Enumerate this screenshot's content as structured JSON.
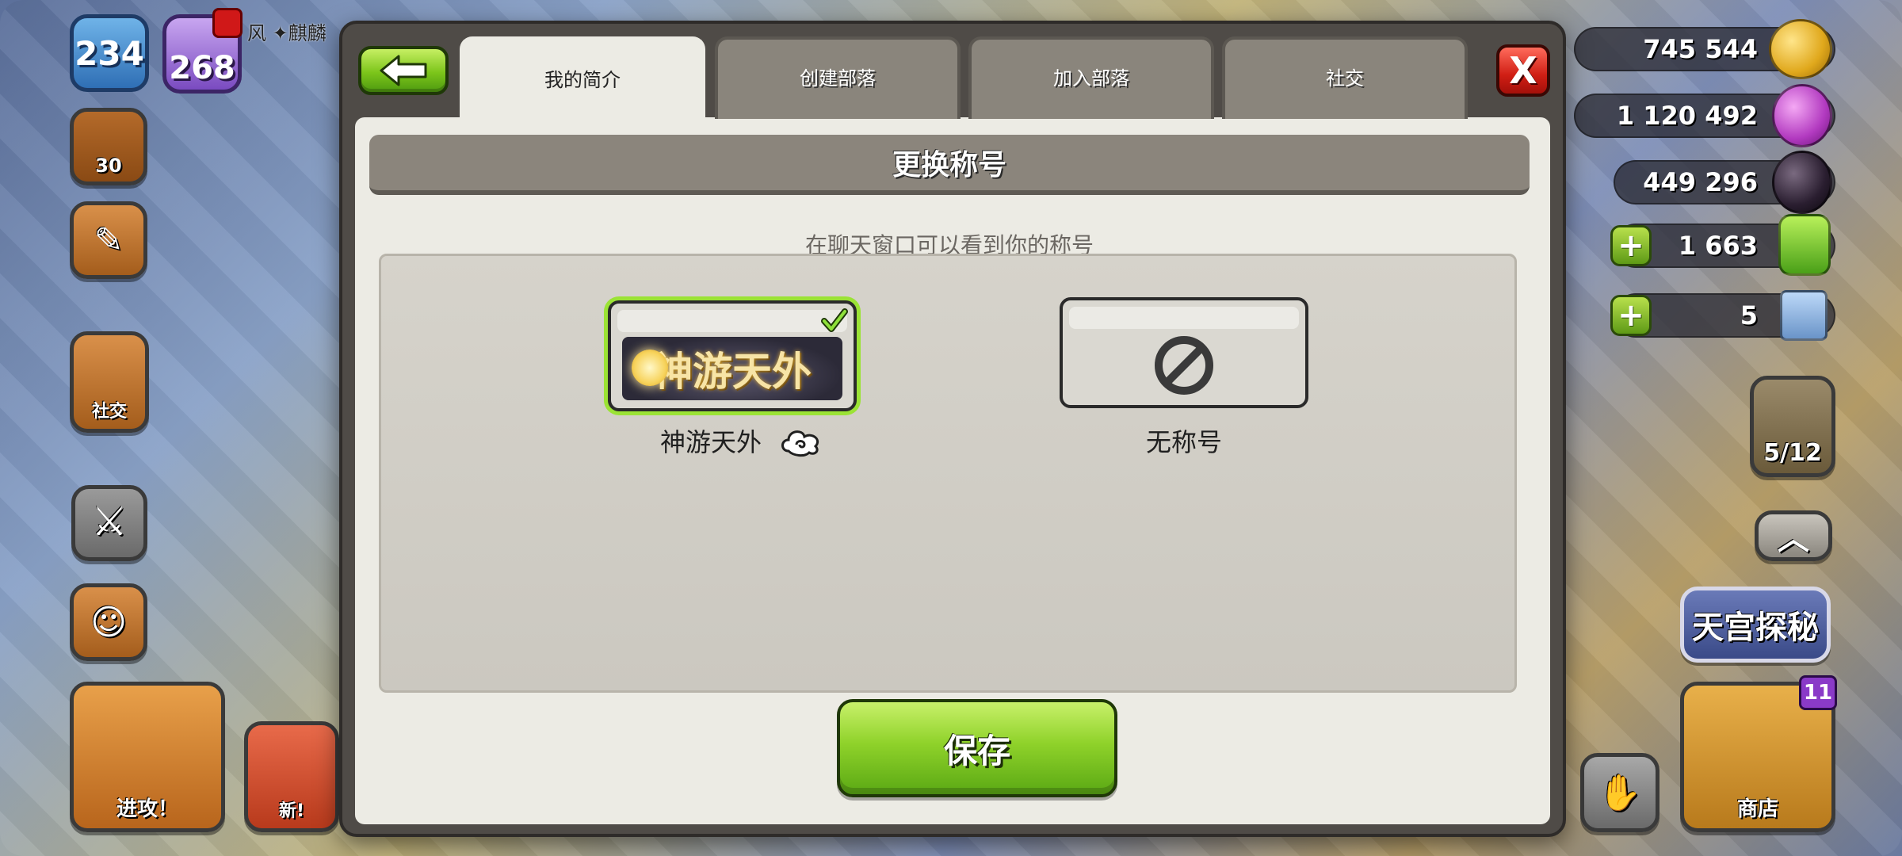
{
  "hud": {
    "level": "234",
    "trophies": "268",
    "player_name": "风 ✦麒麟",
    "builder_level": "30",
    "social_label": "社交",
    "attack_label": "进攻！",
    "new_label": "新!",
    "shop_label": "商店",
    "shop_badge": "11",
    "builders": "5/12",
    "event_banner": "天宫探秘"
  },
  "resources": {
    "gold": "745 544",
    "elixir": "1 120 492",
    "dark_elixir": "449 296",
    "gems": "1 663",
    "passes": "5"
  },
  "modal": {
    "tabs": [
      "我的简介",
      "创建部落",
      "加入部落",
      "社交"
    ],
    "active_tab": 0,
    "close_label": "X",
    "section_title": "更换称号",
    "subtitle": "在聊天窗口可以看到你的称号",
    "titles": [
      {
        "label": "神游天外",
        "art_text": "神游天外",
        "selected": true
      },
      {
        "label": "无称号",
        "selected": false
      }
    ],
    "save_label": "保存"
  },
  "colors": {
    "green_button": "#7cc51a",
    "red_close": "#d01e14",
    "panel_bg": "#ecebe4",
    "header_bg": "#8b857c",
    "selected_outline": "#9be335"
  }
}
